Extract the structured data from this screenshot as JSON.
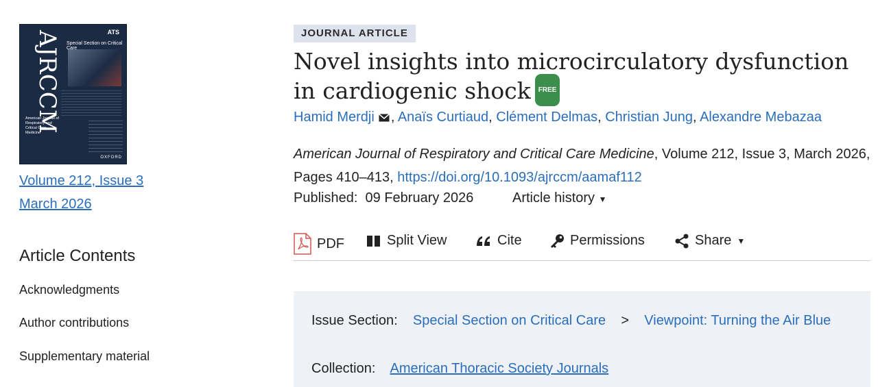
{
  "cover": {
    "journal_abbrev": "AJRCCM",
    "publisher_logo": "ATS",
    "section": "Special Section on Critical Care",
    "journal_name": "American Journal of Respiratory and Critical Care Medicine",
    "press": "OXFORD"
  },
  "issue_link": {
    "volume": "Volume 212, Issue 3",
    "date": "March 2026"
  },
  "article_contents": {
    "heading": "Article Contents",
    "items": [
      "Acknowledgments",
      "Author contributions",
      "Supplementary material"
    ]
  },
  "article": {
    "type_badge": "JOURNAL ARTICLE",
    "title": "Novel insights into microcirculatory dysfunction in cardiogenic shock",
    "free_label": "FREE",
    "authors": [
      "Hamid Merdji",
      "Anaïs Curtiaud",
      "Clément Delmas",
      "Christian Jung",
      "Alexandre Mebazaa"
    ],
    "journal": "American Journal of Respiratory and Critical Care Medicine",
    "citation_rest": ", Volume 212, Issue 3, March 2026, Pages 410–413, ",
    "doi": "https://doi.org/10.1093/ajrccm/aamaf112",
    "published_label": "Published:",
    "published_date": "09 February 2026",
    "history_label": "Article history"
  },
  "toolbar": {
    "pdf": "PDF",
    "split_view": "Split View",
    "cite": "Cite",
    "permissions": "Permissions",
    "share": "Share"
  },
  "issue_info": {
    "section_label": "Issue Section:",
    "section_link1": "Special Section on Critical Care",
    "separator": ">",
    "section_link2": "Viewpoint: Turning the Air Blue",
    "collection_label": "Collection:",
    "collection_link": "American Thoracic Society Journals"
  },
  "colors": {
    "link": "#2a6ebb",
    "free_badge": "#3b8e4b",
    "badge_bg": "#dde2ec",
    "pdf_icon": "#d9534f"
  }
}
